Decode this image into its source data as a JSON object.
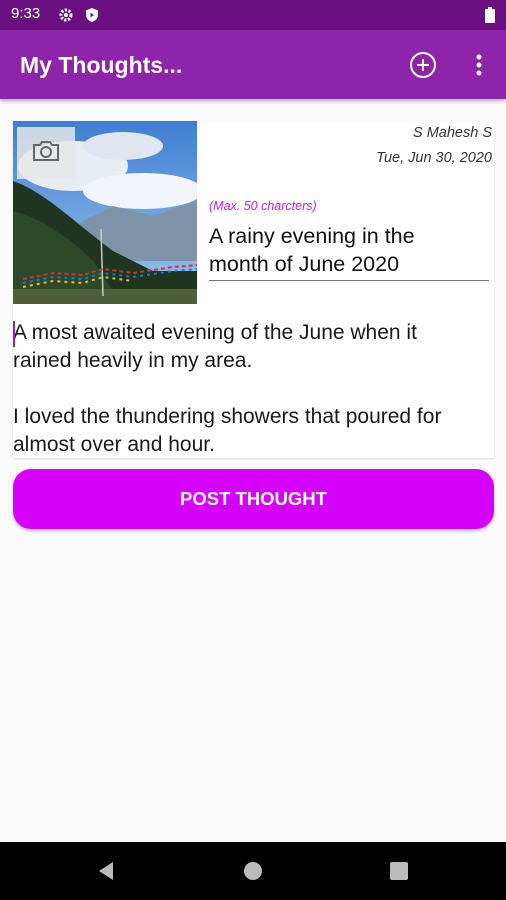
{
  "status_bar": {
    "time": "9:33",
    "icons": [
      "settings-icon",
      "shield-icon",
      "battery-icon"
    ]
  },
  "app_bar": {
    "title": "My Thoughts...",
    "actions": [
      "add-circle-icon",
      "more-vert-icon"
    ],
    "color": "#8e24aa"
  },
  "card": {
    "author": "S Mahesh S",
    "date": "Tue, Jun 30, 2020",
    "title_hint": "(Max. 50 charcters)",
    "title_value": "A rainy evening in the\nmonth of June 2020",
    "body_value": "A most awaited evening of the June when it\nrained heavily in my area.\n\nI loved the thundering showers that poured for\nalmost over and hour.",
    "camera_icon": "camera-icon"
  },
  "post_button": {
    "label": "POST THOUGHT",
    "color": "#d500f9"
  },
  "nav_bar": {
    "icons": [
      "back-icon",
      "home-icon",
      "recents-icon"
    ]
  }
}
